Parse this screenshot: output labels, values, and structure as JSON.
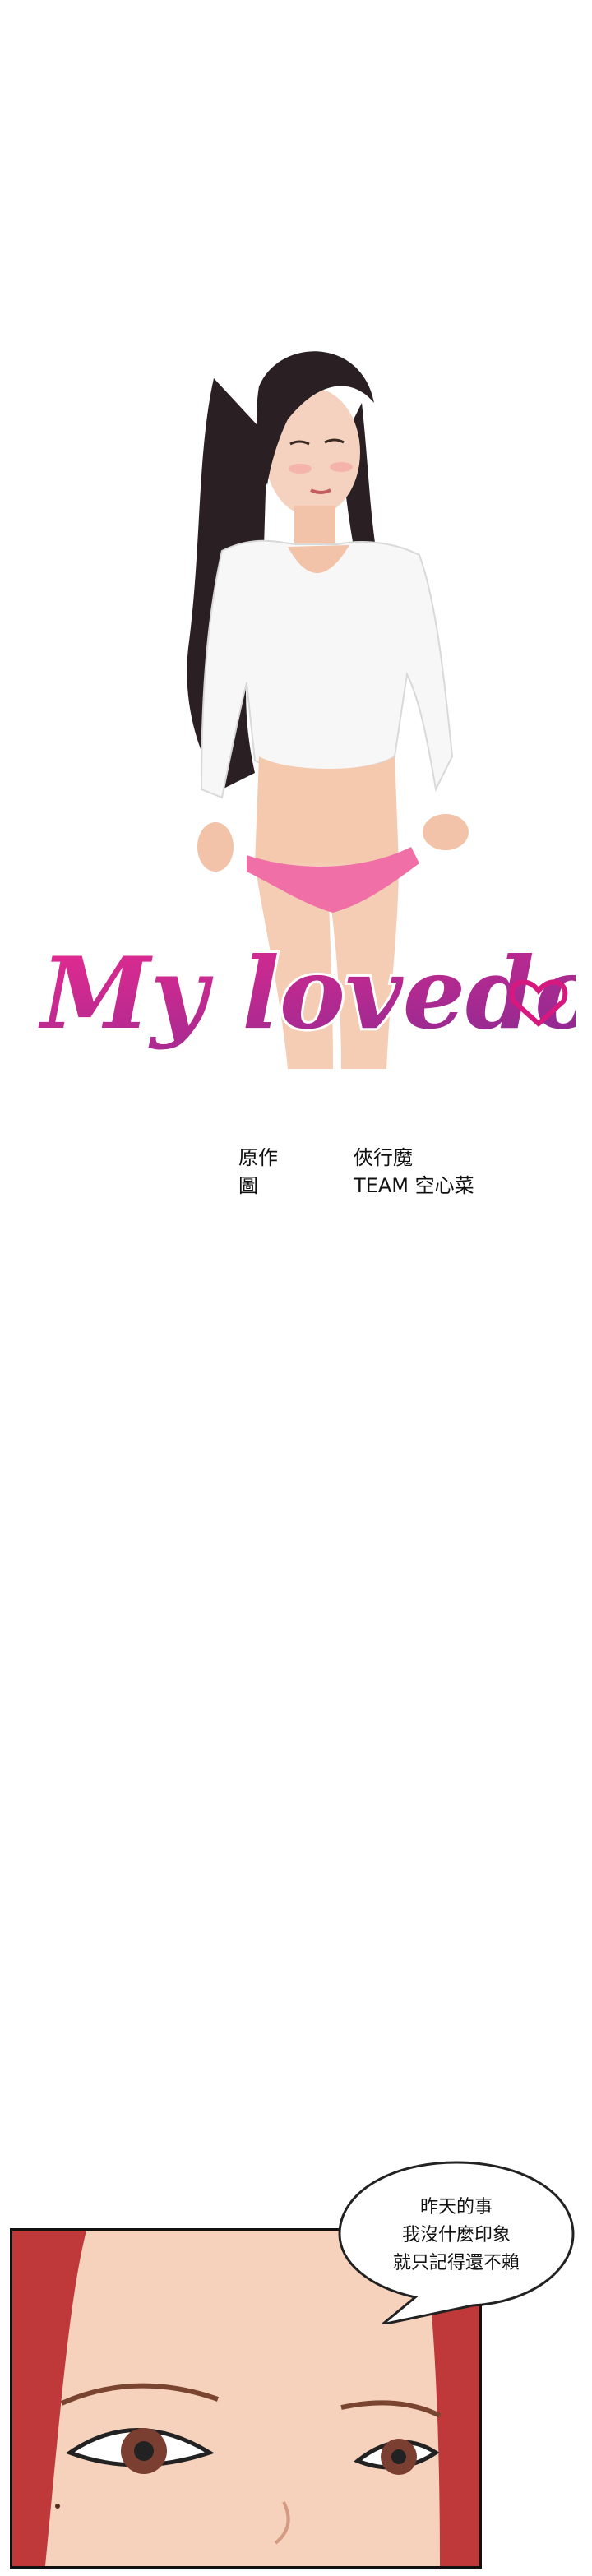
{
  "title_logo": "My lovedoll",
  "credits": [
    {
      "label": "原作",
      "value": "俠行魔"
    },
    {
      "label": "圖",
      "value": "TEAM 空心菜"
    }
  ],
  "speech_bubble": {
    "lines": [
      "昨天的事",
      "我沒什麼印象",
      "就只記得還不賴"
    ]
  },
  "colors": {
    "logo_pink": "#d7187f",
    "logo_purple": "#7e2a92",
    "panties": "#f06fa6",
    "hair": "#2a1f22",
    "skin": "#f2c3a8",
    "red_hair": "#c0393a"
  },
  "icons": [
    "heart-icon"
  ]
}
